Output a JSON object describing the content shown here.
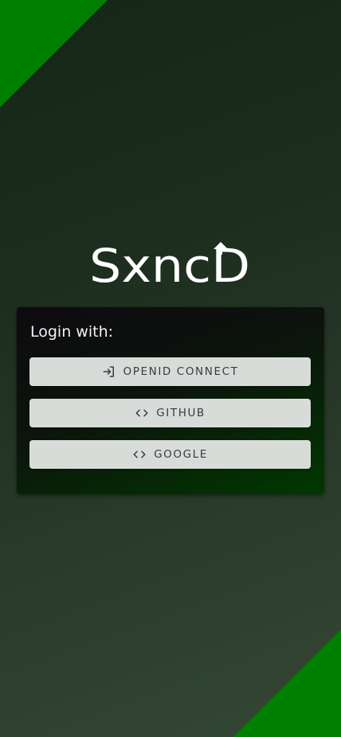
{
  "app": {
    "logo_text": "SxncD"
  },
  "colors": {
    "accent": "#008000",
    "button_bg": "#d8dcd8",
    "button_text": "#3a3a42"
  },
  "login": {
    "title": "Login with:",
    "buttons": [
      {
        "label": "OPENID CONNECT",
        "icon": "login-icon"
      },
      {
        "label": "GITHUB",
        "icon": "code-icon"
      },
      {
        "label": "GOOGLE",
        "icon": "code-icon"
      }
    ]
  }
}
